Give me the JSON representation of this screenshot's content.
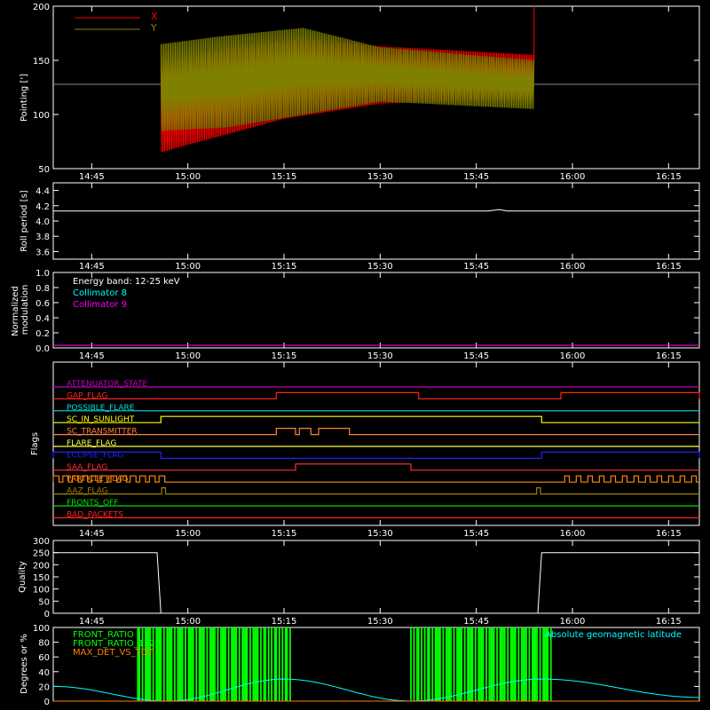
{
  "colors": {
    "background": "#000000",
    "axes": "#ffffff",
    "x_series": "#ff0000",
    "y_series": "#808000",
    "collimator8": "#00ffff",
    "collimator9": "#ff00ff",
    "front_ratio": "#00ff00",
    "geomag": "#00ffff",
    "max_det": "#ff8000"
  },
  "time_ticks": [
    "14:45",
    "15:00",
    "15:15",
    "15:30",
    "15:45",
    "16:00",
    "16:15"
  ],
  "chart_data": [
    {
      "type": "line",
      "ylabel": "Pointing [']",
      "ylim": [
        50,
        200
      ],
      "yticks": [
        "50",
        "100",
        "150",
        "200"
      ],
      "reference_line": 128,
      "legend": [
        "X",
        "Y"
      ],
      "series": [
        {
          "name": "X",
          "color": "#ff0000",
          "start": "14:56",
          "end": "15:55",
          "upper": [
            [
              14.93,
              145
            ],
            [
              15.08,
              160
            ],
            [
              15.3,
              170
            ],
            [
              15.5,
              163
            ],
            [
              15.9,
              155
            ]
          ],
          "lower": [
            [
              14.93,
              65
            ],
            [
              15.0,
              72
            ],
            [
              15.25,
              96
            ],
            [
              15.5,
              110
            ],
            [
              15.9,
              115
            ]
          ]
        },
        {
          "name": "Y",
          "color": "#808000",
          "start": "14:56",
          "end": "15:55",
          "upper": [
            [
              14.93,
              165
            ],
            [
              15.08,
              172
            ],
            [
              15.3,
              180
            ],
            [
              15.5,
              162
            ],
            [
              15.9,
              150
            ]
          ],
          "lower": [
            [
              14.93,
              85
            ],
            [
              15.1,
              88
            ],
            [
              15.3,
              100
            ],
            [
              15.5,
              112
            ],
            [
              15.9,
              105
            ]
          ]
        }
      ]
    },
    {
      "type": "line",
      "ylabel": "Roll period [s]",
      "ylim": [
        3.5,
        4.5
      ],
      "yticks": [
        "3.6",
        "3.8",
        "4.0",
        "4.2",
        "4.4"
      ],
      "series": [
        {
          "name": "",
          "values": [
            [
              14.65,
              4.13
            ],
            [
              15.78,
              4.13
            ],
            [
              15.81,
              4.15
            ],
            [
              15.83,
              4.13
            ],
            [
              16.33,
              4.13
            ]
          ]
        }
      ]
    },
    {
      "type": "line",
      "ylabel": "Normalized modulation",
      "ylim": [
        0,
        1
      ],
      "yticks": [
        "0.0",
        "0.2",
        "0.4",
        "0.6",
        "0.8",
        "1.0"
      ],
      "annotations": [
        "Energy band: 12-25 keV",
        "Collimator 8",
        "Collimator 9"
      ],
      "series": [
        {
          "name": "Collimator 9",
          "values": [
            [
              14.65,
              0.0
            ],
            [
              16.33,
              0.0
            ]
          ]
        }
      ]
    },
    {
      "type": "line",
      "ylabel": "Flags",
      "flags": [
        {
          "label": "ATTENUATOR_STATE",
          "color": "#c000c0",
          "on": []
        },
        {
          "label": "GAP_FLAG",
          "color": "#ff2020",
          "on": [
            [
              15.23,
              15.6
            ],
            [
              15.97,
              16.33
            ]
          ]
        },
        {
          "label": "POSSIBLE_FLARE",
          "color": "#00e0e0",
          "on": []
        },
        {
          "label": "SC_IN_SUNLIGHT",
          "color": "#ffff00",
          "on": [
            [
              14.93,
              15.92
            ]
          ]
        },
        {
          "label": "SC_TRANSMITTER",
          "color": "#ff8040",
          "on": [
            [
              15.23,
              15.28
            ],
            [
              15.29,
              15.32
            ],
            [
              15.34,
              15.42
            ]
          ]
        },
        {
          "label": "FLARE_FLAG",
          "color": "#ffff40",
          "on": []
        },
        {
          "label": "ECLIPSE_FLAG",
          "color": "#2020ff",
          "on": [
            [
              14.65,
              14.93
            ],
            [
              15.92,
              16.33
            ]
          ]
        },
        {
          "label": "SAA_FLAG",
          "color": "#ff3030",
          "on": [
            [
              15.28,
              15.58
            ]
          ]
        },
        {
          "label": "PARTICLE_FLAG",
          "color": "#ff8800",
          "on": [
            [
              14.65,
              14.93
            ],
            [
              15.98,
              16.33
            ]
          ]
        },
        {
          "label": "AAZ_FLAG",
          "color": "#a08000",
          "on": [
            [
              14.932,
              14.942
            ],
            [
              15.907,
              15.917
            ]
          ]
        },
        {
          "label": "FRONTS_OFF",
          "color": "#00e000",
          "on": []
        },
        {
          "label": "BAD_PACKETS",
          "color": "#ff2020",
          "on": []
        }
      ]
    },
    {
      "type": "line",
      "ylabel": "Quality",
      "ylim": [
        0,
        300
      ],
      "yticks": [
        "0",
        "50",
        "100",
        "150",
        "200",
        "250",
        "300"
      ],
      "series": [
        {
          "name": "",
          "values": [
            [
              14.65,
              250
            ],
            [
              14.92,
              250
            ],
            [
              14.93,
              0
            ],
            [
              15.91,
              0
            ],
            [
              15.92,
              250
            ],
            [
              16.33,
              250
            ]
          ]
        }
      ]
    },
    {
      "type": "line",
      "ylabel": "Degrees or %",
      "ylim": [
        0,
        100
      ],
      "yticks": [
        "0",
        "20",
        "40",
        "60",
        "80",
        "100"
      ],
      "legend": [
        "FRONT_RATIO",
        "FRONT_RATIO_1225",
        "MAX_DET_VS_TOT",
        "Absolute geomagnetic latitude"
      ],
      "series": [
        {
          "name": "Absolute geomagnetic latitude",
          "values": [
            [
              14.65,
              20
            ],
            [
              14.95,
              0
            ],
            [
              15.25,
              30
            ],
            [
              15.58,
              0
            ],
            [
              15.92,
              30
            ],
            [
              16.33,
              5
            ]
          ]
        },
        {
          "name": "FRONT_RATIO",
          "bands": [
            [
              14.87,
              15.27
            ],
            [
              15.58,
              15.95
            ]
          ]
        }
      ]
    }
  ]
}
